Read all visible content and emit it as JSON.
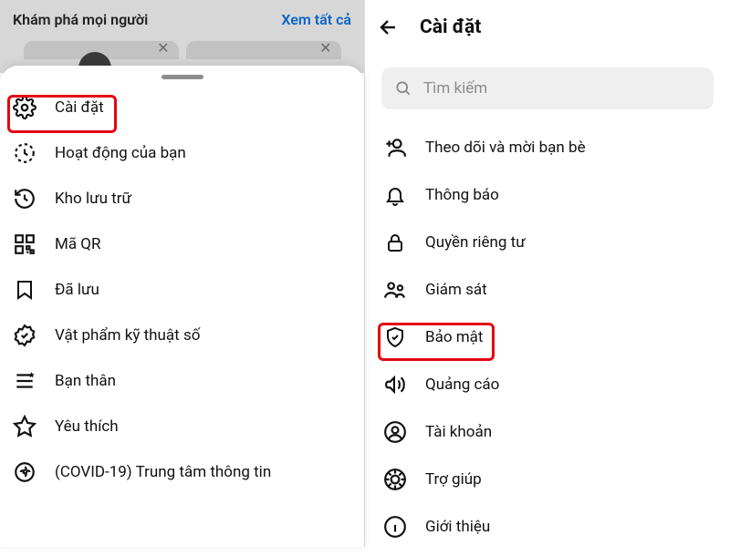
{
  "left": {
    "discover_title": "Khám phá mọi người",
    "see_all": "Xem tất cả",
    "menu": [
      {
        "icon": "gear-icon",
        "label": "Cài đặt"
      },
      {
        "icon": "activity-icon",
        "label": "Hoạt động của bạn"
      },
      {
        "icon": "archive-icon",
        "label": "Kho lưu trữ"
      },
      {
        "icon": "qr-icon",
        "label": "Mã QR"
      },
      {
        "icon": "bookmark-icon",
        "label": "Đã lưu"
      },
      {
        "icon": "verified-icon",
        "label": "Vật phẩm kỹ thuật số"
      },
      {
        "icon": "close-friends-icon",
        "label": "Bạn thân"
      },
      {
        "icon": "star-icon",
        "label": "Yêu thích"
      },
      {
        "icon": "covid-icon",
        "label": "(COVID-19) Trung tâm thông tin"
      }
    ]
  },
  "right": {
    "title": "Cài đặt",
    "search_placeholder": "Tìm kiếm",
    "items": [
      {
        "icon": "follow-invite-icon",
        "label": "Theo dõi và mời bạn bè"
      },
      {
        "icon": "bell-icon",
        "label": "Thông báo"
      },
      {
        "icon": "lock-icon",
        "label": "Quyền riêng tư"
      },
      {
        "icon": "supervision-icon",
        "label": "Giám sát"
      },
      {
        "icon": "shield-icon",
        "label": "Bảo mật"
      },
      {
        "icon": "megaphone-icon",
        "label": "Quảng cáo"
      },
      {
        "icon": "account-icon",
        "label": "Tài khoản"
      },
      {
        "icon": "help-icon",
        "label": "Trợ giúp"
      },
      {
        "icon": "about-icon",
        "label": "Giới thiệu"
      }
    ]
  }
}
